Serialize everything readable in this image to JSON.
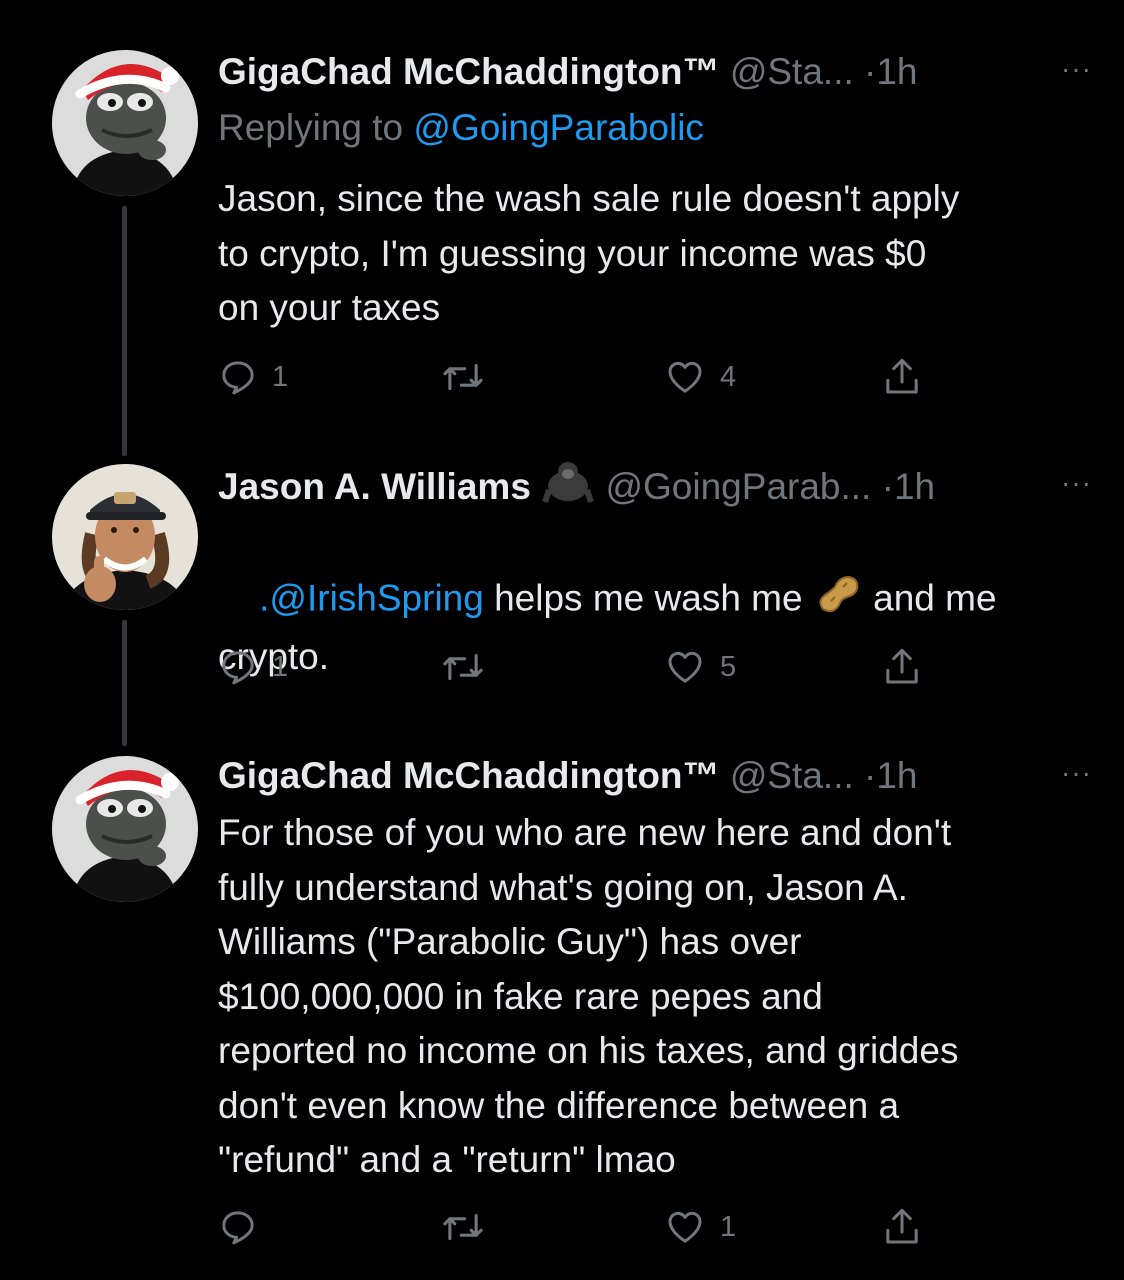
{
  "colors": {
    "background": "#000000",
    "text": "#e7e9ea",
    "secondary": "#71767b",
    "link": "#1d9bf0",
    "thread_line": "#333639"
  },
  "tweets": [
    {
      "name": "GigaChad McChaddington™",
      "handle": "@Sta...",
      "dot": "·",
      "time": "1h",
      "replying_prefix": "Replying to ",
      "replying_to": "@GoingParabolic",
      "text": "Jason, since the wash sale rule doesn't apply\nto crypto, I'm guessing your income was $0\non your taxes",
      "actions": {
        "replies": "1",
        "retweets": "",
        "likes": "4"
      },
      "avatar": "pepe-santa-avatar"
    },
    {
      "name": "Jason A. Williams",
      "name_emoji": "gorilla-emoji",
      "handle": "@GoingParab...",
      "dot": "·",
      "time": "1h",
      "text_link": ".@IrishSpring",
      "text_mid": " helps me wash me ",
      "text_emoji": "peanut-emoji",
      "text_after": " and me",
      "text_line2": "crypto.",
      "actions": {
        "replies": "1",
        "retweets": "",
        "likes": "5"
      },
      "avatar": "man-thumbs-up-avatar"
    },
    {
      "name": "GigaChad McChaddington™",
      "handle": "@Sta...",
      "dot": "·",
      "time": "1h",
      "text": "For those of you who are new here and don't\nfully understand what's going on, Jason A.\nWilliams (\"Parabolic Guy\") has over\n$100,000,000 in fake rare pepes and\nreported no income on his taxes, and griddes\ndon't even know the difference between a\n\"refund\" and a \"return\" lmao",
      "actions": {
        "replies": "",
        "retweets": "",
        "likes": "1"
      },
      "avatar": "pepe-santa-avatar"
    }
  ],
  "more_label": "···"
}
